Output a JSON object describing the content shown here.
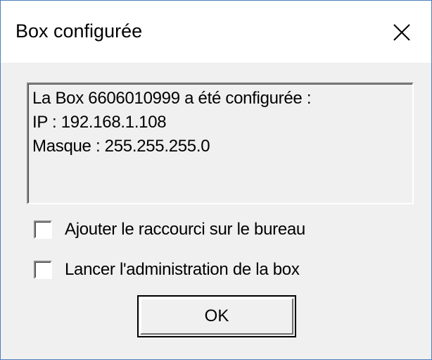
{
  "window": {
    "title": "Box configurée",
    "close_icon": "close-icon"
  },
  "message": {
    "lines": [
      "La Box 6606010999 a été configurée :",
      "IP : 192.168.1.108",
      "Masque : 255.255.255.0"
    ]
  },
  "options": [
    {
      "label": "Ajouter le raccourci sur le bureau",
      "checked": false
    },
    {
      "label": "Lancer l'administration de la box",
      "checked": false
    }
  ],
  "buttons": {
    "ok_label": "OK"
  },
  "colors": {
    "dialog_border": "#4d7fb8",
    "client_background": "#f0f0f0",
    "titlebar_background": "#ffffff"
  }
}
